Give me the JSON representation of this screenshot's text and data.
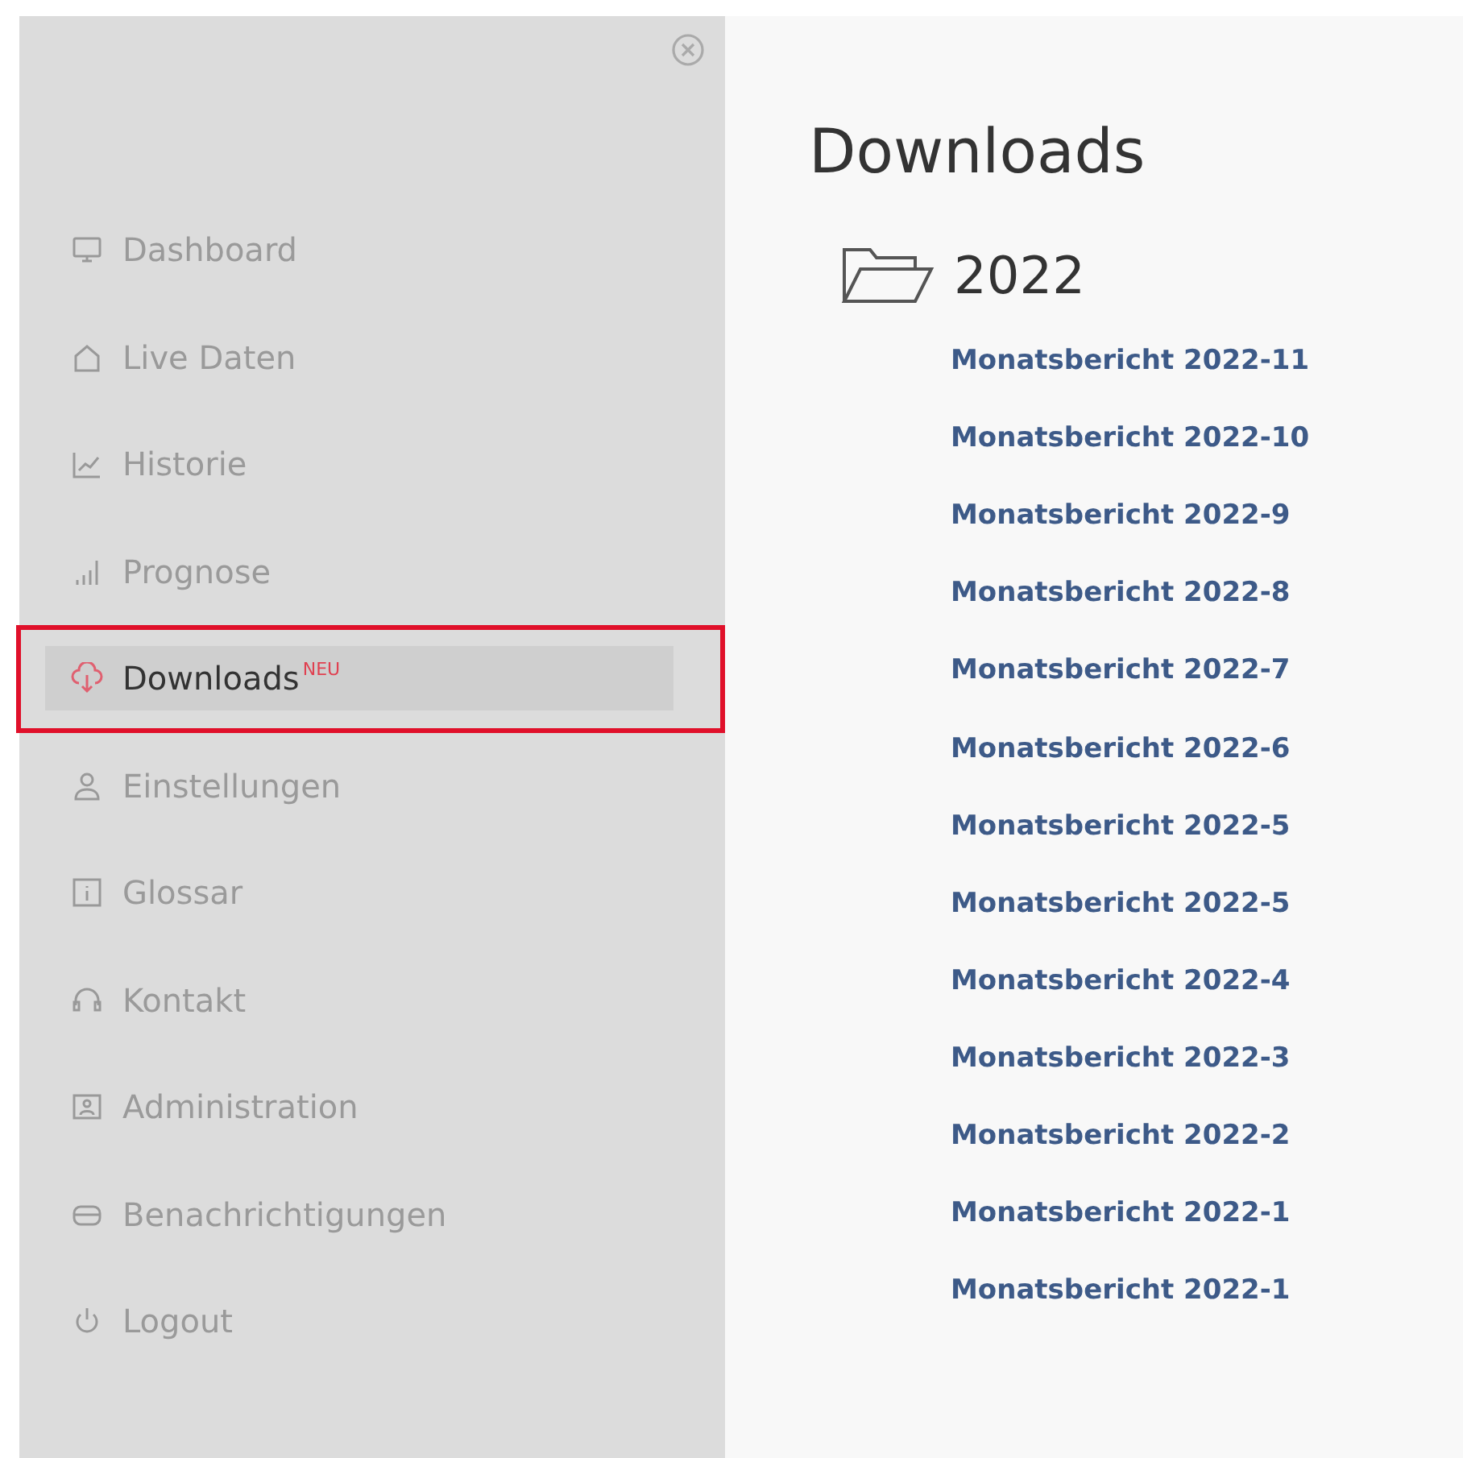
{
  "sidebar": {
    "items": [
      {
        "label": "Dashboard",
        "selected": false
      },
      {
        "label": "Live Daten",
        "selected": false
      },
      {
        "label": "Historie",
        "selected": false
      },
      {
        "label": "Prognose",
        "selected": false
      },
      {
        "label": "Downloads",
        "badge": "NEU",
        "selected": true
      },
      {
        "label": "Einstellungen",
        "selected": false
      },
      {
        "label": "Glossar",
        "selected": false
      },
      {
        "label": "Kontakt",
        "selected": false
      },
      {
        "label": "Administration",
        "selected": false
      },
      {
        "label": "Benachrichtigungen",
        "selected": false
      },
      {
        "label": "Logout",
        "selected": false
      }
    ]
  },
  "main": {
    "title": "Downloads",
    "folder": {
      "name": "2022",
      "files": [
        "Monatsbericht 2022-11",
        "Monatsbericht 2022-10",
        "Monatsbericht 2022-9",
        "Monatsbericht 2022-8",
        "Monatsbericht 2022-7",
        "Monatsbericht 2022-6",
        "Monatsbericht 2022-5",
        "Monatsbericht 2022-5",
        "Monatsbericht 2022-4",
        "Monatsbericht 2022-3",
        "Monatsbericht 2022-2",
        "Monatsbericht 2022-1",
        "Monatsbericht 2022-1"
      ]
    }
  }
}
